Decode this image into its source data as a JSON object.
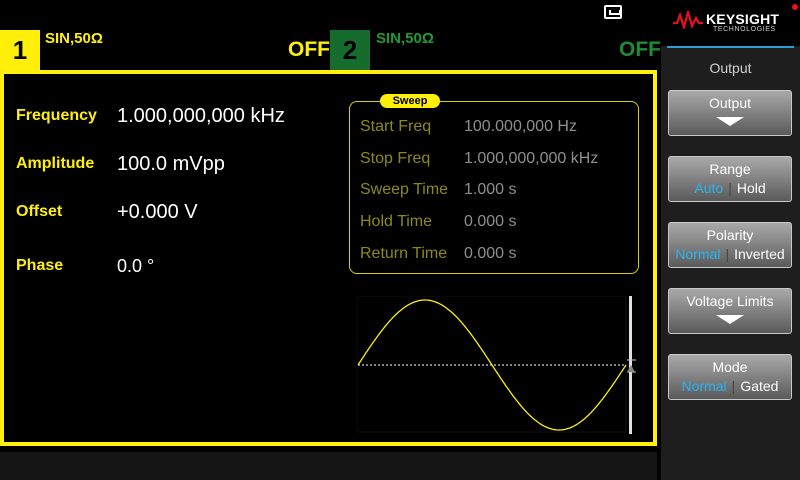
{
  "top_bar": {
    "ch1": {
      "number": "1",
      "label": "SIN,50Ω",
      "state": "OFF"
    },
    "ch2": {
      "number": "2",
      "label": "SIN,50Ω",
      "state": "OFF"
    }
  },
  "params": {
    "frequency": {
      "label": "Frequency",
      "value": "1.000,000,000 kHz"
    },
    "amplitude": {
      "label": "Amplitude",
      "value": "100.0 mVpp"
    },
    "offset": {
      "label": "Offset",
      "value": "+0.000 V"
    },
    "phase": {
      "label": "Phase",
      "value": "0.0 °"
    }
  },
  "sweep": {
    "tag": "Sweep",
    "start_freq": {
      "label": "Start Freq",
      "value": "100.000,000 Hz"
    },
    "stop_freq": {
      "label": "Stop Freq",
      "value": "1.000,000,000 kHz"
    },
    "sweep_time": {
      "label": "Sweep Time",
      "value": "1.000 s"
    },
    "hold_time": {
      "label": "Hold Time",
      "value": "0.000 s"
    },
    "return_time": {
      "label": "Return Time",
      "value": "0.000 s"
    }
  },
  "waveform": {
    "type": "sine",
    "cycles": 1,
    "color": "#ffef0a"
  },
  "logo": {
    "name": "KEYSIGHT",
    "sub": "TECHNOLOGIES"
  },
  "menu": {
    "title": "Output",
    "softkeys": {
      "output": {
        "title": "Output"
      },
      "range": {
        "title": "Range",
        "opt1": "Auto",
        "opt2": "Hold",
        "selected": "Auto"
      },
      "polarity": {
        "title": "Polarity",
        "opt1": "Normal",
        "opt2": "Inverted",
        "selected": "Normal"
      },
      "voltage_limits": {
        "title": "Voltage Limits"
      },
      "mode": {
        "title": "Mode",
        "opt1": "Normal",
        "opt2": "Gated",
        "selected": "Normal"
      }
    }
  },
  "colors": {
    "accent": "#ffef0a",
    "channel2": "#1f9a39",
    "selected_option": "#27b4f2",
    "brand_red": "#e8101a"
  }
}
